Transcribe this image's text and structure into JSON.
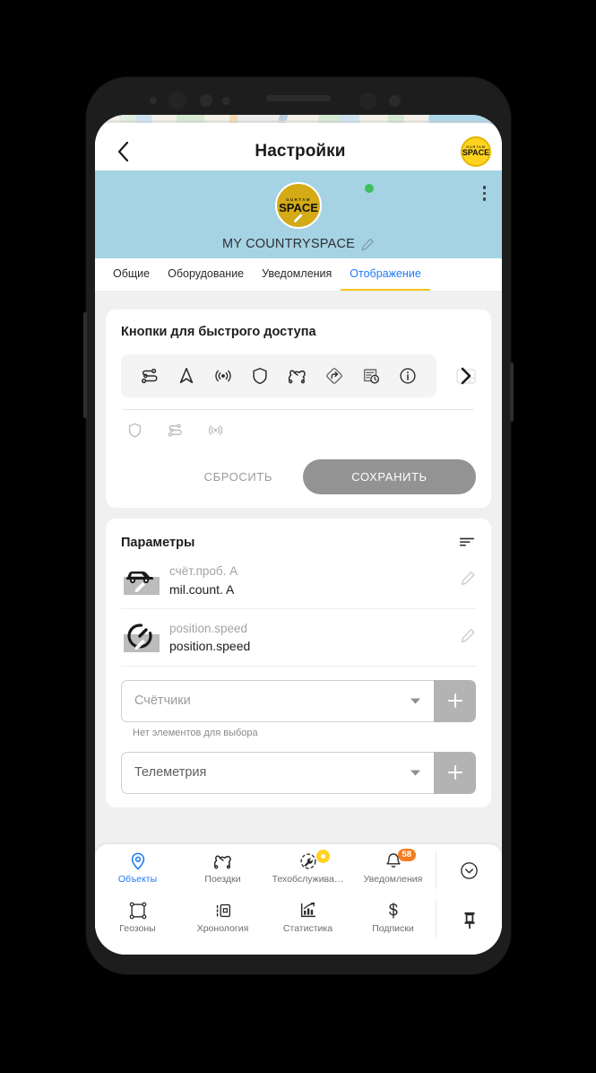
{
  "app_bar": {
    "back_icon": "chevron-left-icon",
    "title": "Настройки",
    "brand_top": "GURTAM",
    "brand_main": "SPACE"
  },
  "hero": {
    "avatar_top": "GURTAM",
    "avatar_main": "SPACE",
    "unit_name": "MY COUNTRYSPACE",
    "edit_icon": "pencil-icon",
    "overflow_icon": "more-vertical-icon",
    "online_status": true,
    "banner_color": "#a5d3e4"
  },
  "tabs": [
    {
      "label": "Общие",
      "active": false
    },
    {
      "label": "Оборудование",
      "active": false
    },
    {
      "label": "Уведомления",
      "active": false
    },
    {
      "label": "Отображение",
      "active": true
    }
  ],
  "quick_access": {
    "title": "Кнопки для быстрого доступа",
    "enabled_icons": [
      "route-icon",
      "navigation-arrow-icon",
      "signal-broadcast-icon",
      "shield-icon",
      "track-trip-icon",
      "turn-right-diamond-icon",
      "report-history-icon",
      "info-circle-icon"
    ],
    "more_icon": "chevron-right-icon",
    "ghost_icon": "settings-panel-icon",
    "disabled_icons": [
      "shield-icon",
      "route-icon",
      "signal-broadcast-icon"
    ],
    "reset_label": "СБРОСИТЬ",
    "save_label": "СОХРАНИТЬ",
    "save_color": "#939393"
  },
  "parameters": {
    "title": "Параметры",
    "sort_icon": "sort-icon",
    "rows": [
      {
        "icon": "car-icon",
        "sub": "счёт.проб. A",
        "main": "mil.count. A",
        "edit_icon": "pencil-icon"
      },
      {
        "icon": "speedometer-icon",
        "sub": "position.speed",
        "main": "position.speed",
        "edit_icon": "pencil-icon"
      }
    ],
    "selects": [
      {
        "placeholder": "Счётчики",
        "filled": false,
        "dropdown_icon": "caret-down-icon",
        "add_icon": "plus-icon",
        "hint": "Нет элементов для выбора"
      },
      {
        "placeholder": "Телеметрия",
        "filled": true,
        "dropdown_icon": "caret-down-icon",
        "add_icon": "plus-icon",
        "hint": ""
      }
    ]
  },
  "bottom_nav": {
    "row1": [
      {
        "label": "Объекты",
        "icon": "location-pin-icon",
        "active": true
      },
      {
        "label": "Поездки",
        "icon": "track-trip-icon",
        "active": false
      },
      {
        "label": "Техобслужива…",
        "icon": "maintenance-wrench-icon",
        "active": false,
        "dot": true
      },
      {
        "label": "Уведомления",
        "icon": "bell-icon",
        "active": false,
        "badge": "58"
      }
    ],
    "row2": [
      {
        "label": "Геозоны",
        "icon": "geofence-icon",
        "active": false
      },
      {
        "label": "Хронология",
        "icon": "timeline-icon",
        "active": false
      },
      {
        "label": "Статистика",
        "icon": "statistics-chart-icon",
        "active": false
      },
      {
        "label": "Подписки",
        "icon": "dollar-icon",
        "active": false
      }
    ],
    "collapse_icon": "chevron-down-circle-icon",
    "pin_icon": "pin-icon",
    "badge_color": "#f57c20",
    "active_color": "#2079f5"
  }
}
